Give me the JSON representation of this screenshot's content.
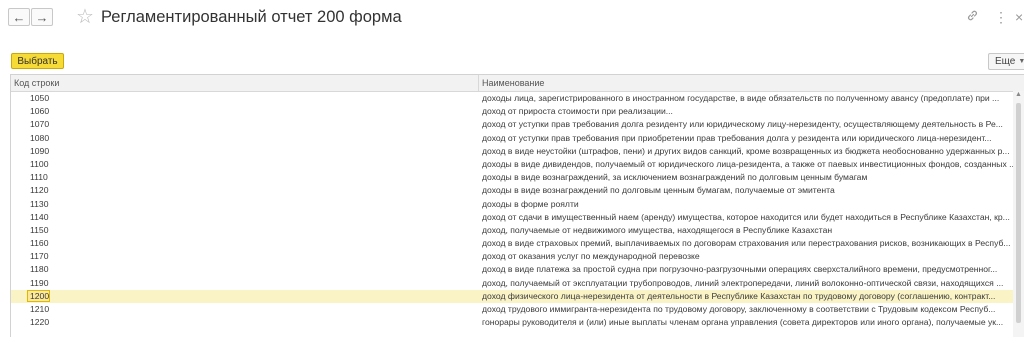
{
  "window": {
    "title": "Регламентированный отчет 200 форма",
    "back_icon": "arrow-left-icon",
    "forward_icon": "arrow-right-icon",
    "star_icon": "star-outline-icon",
    "link_icon": "link-icon",
    "menu_icon": "more-vertical-icon",
    "close_icon": "close-icon"
  },
  "toolbar": {
    "select_label": "Выбрать",
    "more_label": "Еще",
    "accent_color": "#f6da35"
  },
  "table": {
    "columns": [
      "Код строки",
      "Наименование"
    ],
    "selected_code": "1200",
    "rows": [
      {
        "code": "1050",
        "name": "доходы лица, зарегистрированного в иностранном государстве, в виде обязательств по полученному авансу (предоплате) при ..."
      },
      {
        "code": "1060",
        "name": "доход от прироста стоимости при реализации..."
      },
      {
        "code": "1070",
        "name": "доход от уступки прав требования долга резиденту или юридическому лицу-нерезиденту, осуществляющему деятельность в Ре..."
      },
      {
        "code": "1080",
        "name": "доход от уступки прав требования при приобретении прав требования долга у резидента или юридического лица-нерезидент..."
      },
      {
        "code": "1090",
        "name": "доход в виде неустойки (штрафов, пени) и других видов санкций, кроме возвращенных из бюджета необоснованно удержанных р..."
      },
      {
        "code": "1100",
        "name": "доходы в виде дивидендов, получаемый от юридического лица-резидента, а также от паевых инвестиционных фондов, созданных ..."
      },
      {
        "code": "1110",
        "name": "доходы в виде вознаграждений, за исключением вознаграждений по долговым ценным бумагам"
      },
      {
        "code": "1120",
        "name": "доходы в виде вознаграждений по долговым ценным бумагам, получаемые от эмитента"
      },
      {
        "code": "1130",
        "name": "доходы в форме роялти"
      },
      {
        "code": "1140",
        "name": "доход от сдачи в имущественный наем (аренду) имущества, которое находится или будет находиться в Республике Казахстан, кр..."
      },
      {
        "code": "1150",
        "name": "доход, получаемые от недвижимого имущества, находящегося в Республике Казахстан"
      },
      {
        "code": "1160",
        "name": "доход в виде страховых премий, выплачиваемых по договорам страхования или перестрахования рисков, возникающих в Респуб..."
      },
      {
        "code": "1170",
        "name": "доход от оказания услуг по международной перевозке"
      },
      {
        "code": "1180",
        "name": "доход в виде платежа за простой судна при погрузочно-разгрузочными операциях сверхсталийного времени, предусмотренног..."
      },
      {
        "code": "1190",
        "name": "доход, получаемый от эксплуатации трубопроводов, линий электропередачи, линий волоконно-оптической связи, находящихся ..."
      },
      {
        "code": "1200",
        "name": "доход физического лица-нерезидента от деятельности в Республике Казахстан по трудовому договору (соглашению, контракт..."
      },
      {
        "code": "1210",
        "name": "доход трудового иммигранта-нерезидента по трудовому договору, заключенному в соответствии с Трудовым кодексом Респуб..."
      },
      {
        "code": "1220",
        "name": "гонорары руководителя и (или) иные выплаты членам органа управления (совета директоров или иного органа), получаемые ук..."
      }
    ]
  }
}
